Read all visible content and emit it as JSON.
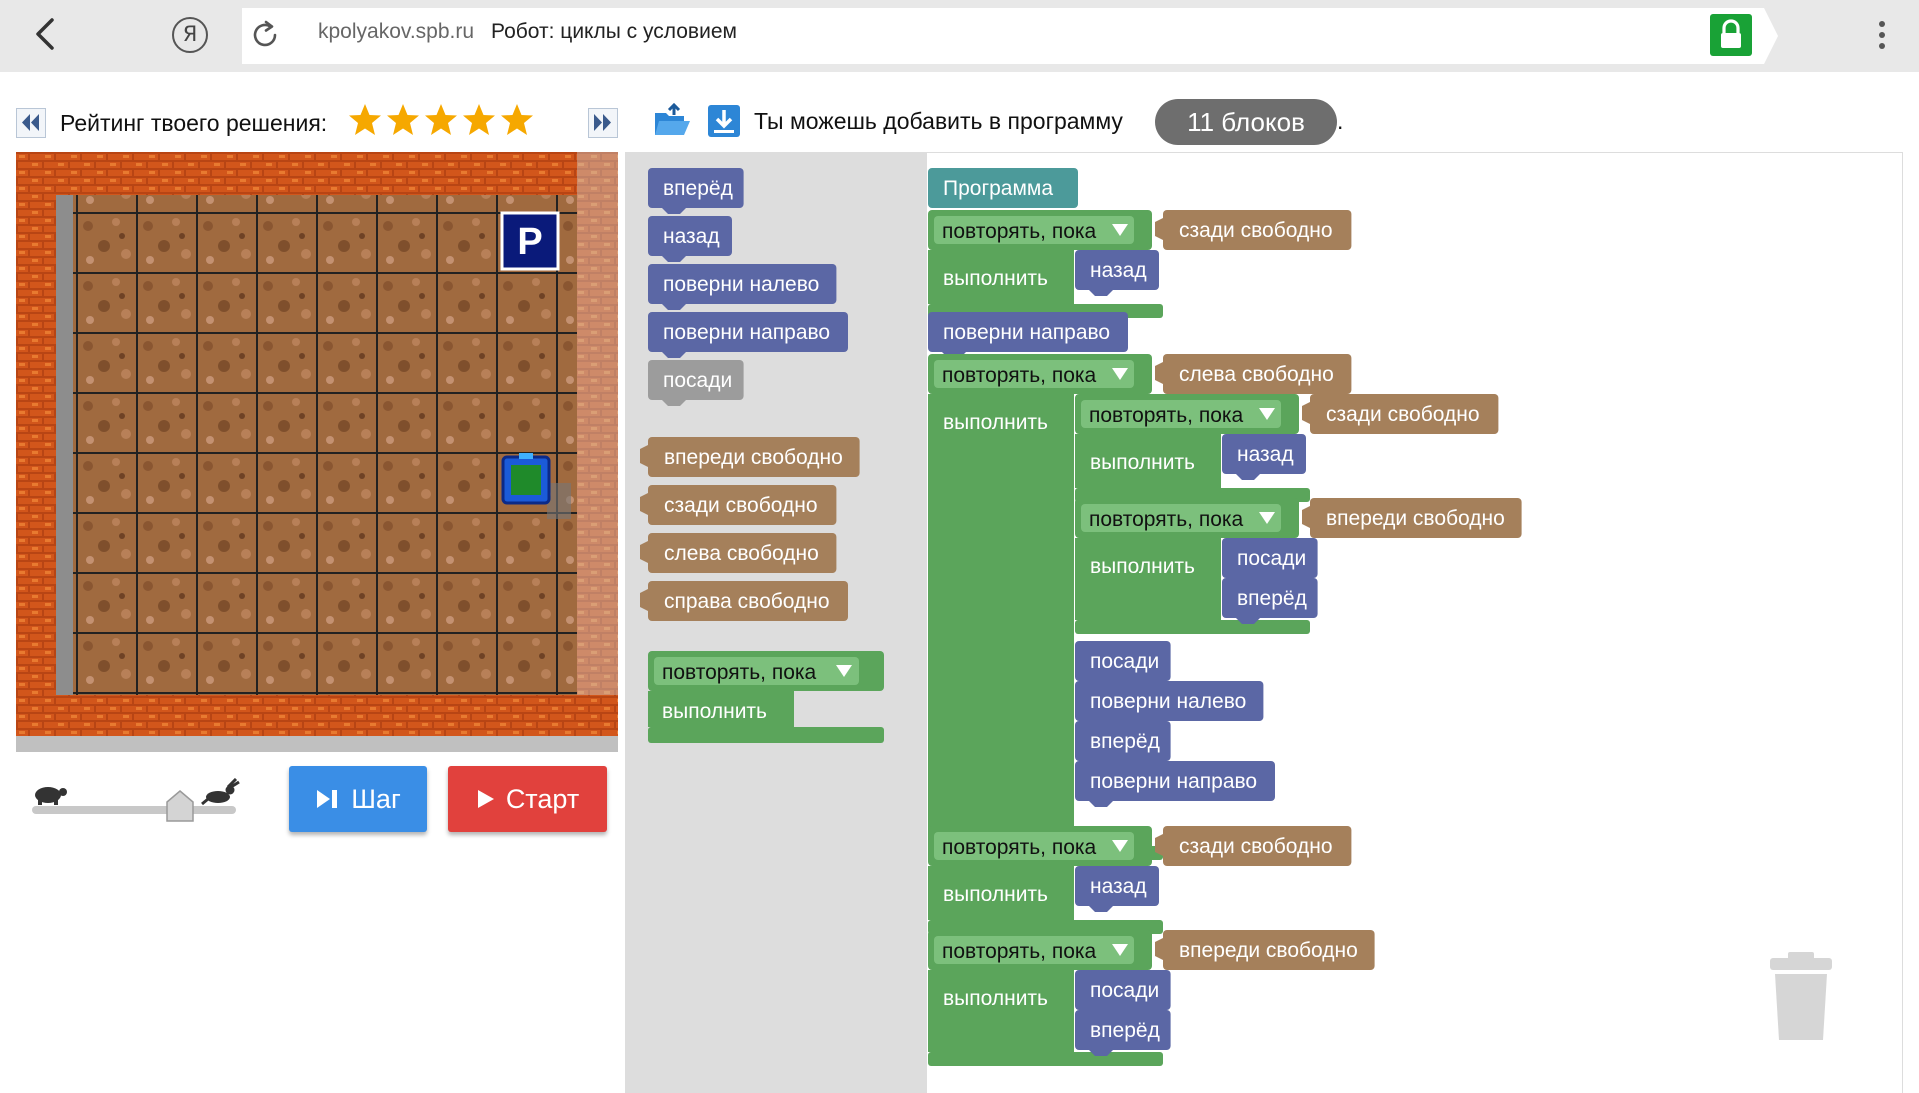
{
  "browser": {
    "domain": "kpolyakov.spb.ru",
    "page_title": "Робот: циклы с условием",
    "yandex_glyph": "Я",
    "icons": [
      "back-arrow-icon",
      "yandex-icon",
      "reload-icon",
      "lock-icon",
      "more-vert-icon"
    ],
    "lock_color": "#19a236"
  },
  "rating": {
    "label": "Рейтинг твоего решения:",
    "stars": 5,
    "star_color": "#f6a800"
  },
  "field": {
    "columns": 8,
    "rows": 8,
    "parking_label": "P",
    "parking_color": "#0a1a7a",
    "wall_color": "#d2561b",
    "floor_color": "#a06a3f"
  },
  "controls": {
    "step_label": "Шаг",
    "start_label": "Старт",
    "speed_level": 0.75,
    "step_color": "#3a8ee6",
    "start_color": "#e1413d"
  },
  "header": {
    "hint_prefix": "Ты можешь добавить в программу",
    "blocks_left": "11 блоков",
    "hint_suffix": "."
  },
  "colors": {
    "action_block": "#5b67a5",
    "condition_block": "#a5805b",
    "loop_block": "#5ba55b",
    "program_block": "#4c9a9a",
    "toolbox_bg": "#dddddd"
  },
  "toolbox": {
    "actions": [
      "вперёд",
      "назад",
      "поверни налево",
      "поверни направо",
      "посади"
    ],
    "conditions": [
      "впереди свободно",
      "сзади свободно",
      "слева свободно",
      "справа свободно"
    ],
    "loop_header": "повторять, пока",
    "loop_body": "выполнить"
  },
  "program": {
    "root": "Программа",
    "loop_label": "повторять, пока",
    "do_label": "выполнить",
    "blocks": {
      "l1_cond": "сзади свободно",
      "l1_a1": "назад",
      "t2": "поверни направо",
      "l3_cond": "слева свободно",
      "l3a_cond": "сзади свободно",
      "l3a_a1": "назад",
      "l3b_cond": "впереди свободно",
      "l3b_a1": "посади",
      "l3b_a2": "вперёд",
      "l3_a1": "посади",
      "l3_a2": "поверни налево",
      "l3_a3": "вперёд",
      "l3_a4": "поверни направо",
      "l4_cond": "сзади свободно",
      "l4_a1": "назад",
      "l5_cond": "впереди свободно",
      "l5_a1": "посади",
      "l5_a2": "вперёд"
    }
  }
}
